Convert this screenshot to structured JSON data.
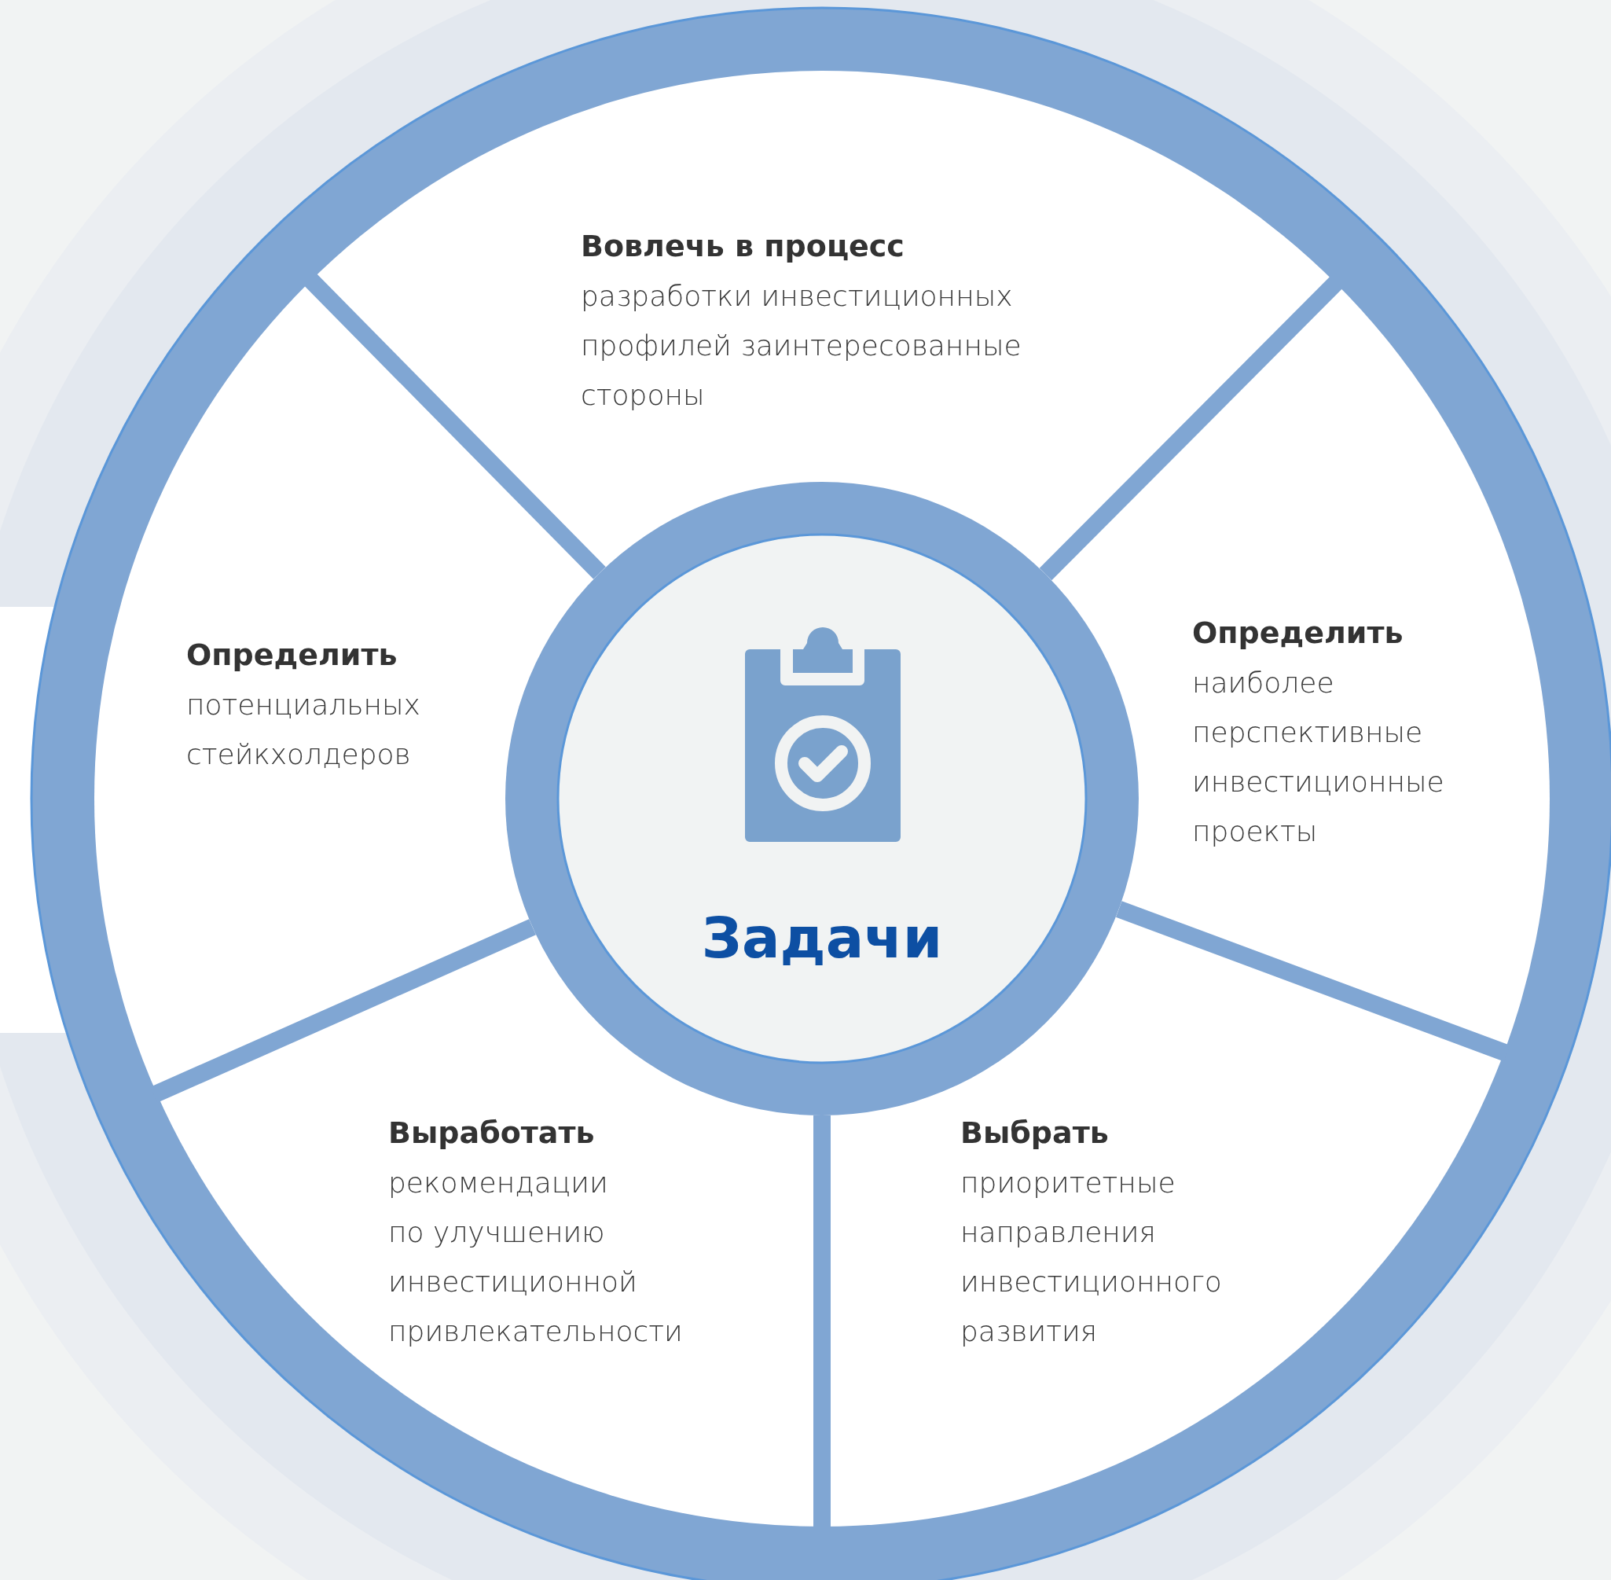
{
  "center": {
    "title": "Задачи"
  },
  "segments": [
    {
      "kind": "top",
      "title": "Вовлечь в процесс",
      "lines": [
        "разработки инвестиционных",
        "профилей заинтересованные",
        "стороны"
      ]
    },
    {
      "kind": "left",
      "title": "Определить",
      "lines": [
        "потенциальных",
        "стейкхолдеров"
      ]
    },
    {
      "kind": "right",
      "title": "Определить",
      "lines": [
        "наиболее",
        "перспективные",
        "инвестиционные",
        "проекты"
      ]
    },
    {
      "kind": "bottom-left",
      "title": "Выработать",
      "lines": [
        "рекомендации",
        "по улучшению",
        "инвестиционной",
        "привлекательности"
      ]
    },
    {
      "kind": "bottom-right",
      "title": "Выбрать",
      "lines": [
        "приоритетные",
        "направления",
        "инвестиционного",
        "развития"
      ]
    }
  ]
}
